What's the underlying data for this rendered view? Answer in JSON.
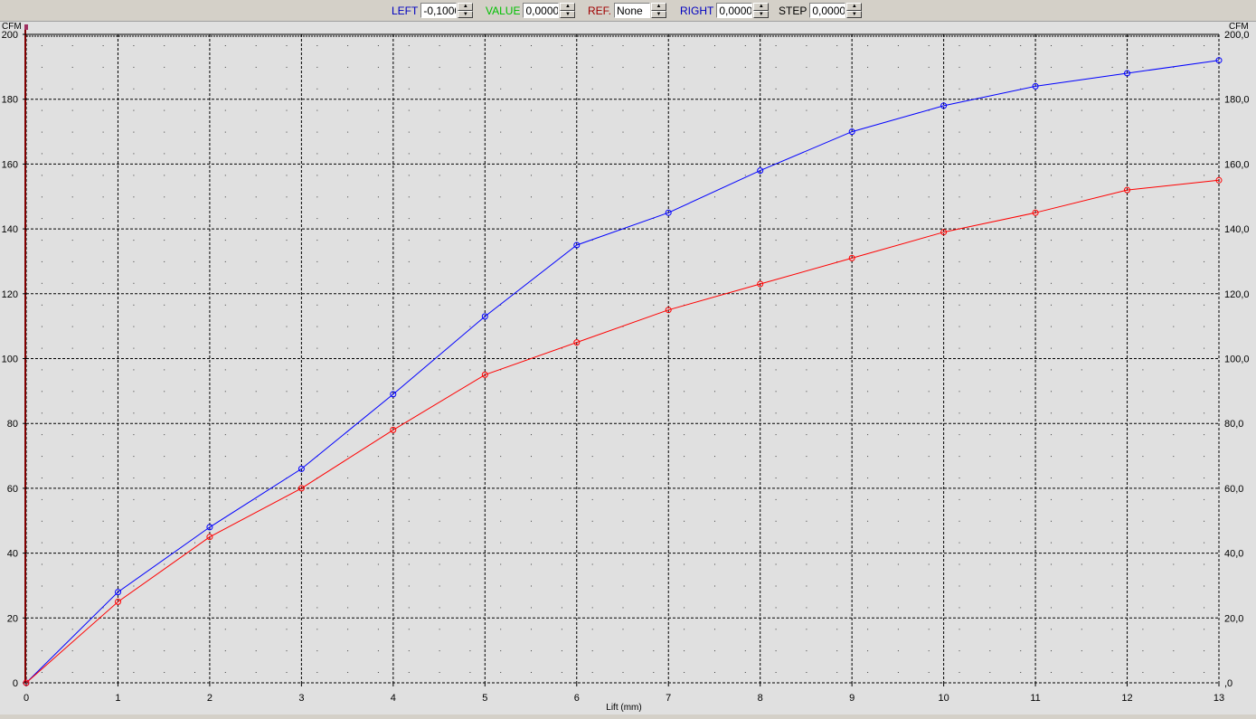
{
  "toolbar": {
    "left": {
      "label": "LEFT",
      "value": "-0,1000",
      "color": "#0000c0"
    },
    "value": {
      "label": "VALUE",
      "value": "0,0000",
      "color": "#00c000"
    },
    "ref": {
      "label": "REF.",
      "value": "None",
      "color": "#a00000"
    },
    "right": {
      "label": "RIGHT",
      "value": "0,0000",
      "color": "#0000c0"
    },
    "step": {
      "label": "STEP",
      "value": "0,0000",
      "color": "#000000"
    }
  },
  "chart_data": {
    "type": "line",
    "xlabel": "Lift (mm)",
    "ylabel_left": "CFM",
    "ylabel_right": "CFM",
    "xlim": [
      0,
      13
    ],
    "ylim": [
      0,
      200
    ],
    "x_ticks": [
      "0",
      "1",
      "2",
      "3",
      "4",
      "5",
      "6",
      "7",
      "8",
      "9",
      "10",
      "11",
      "12",
      "13"
    ],
    "y_ticks_left": [
      "0",
      "20",
      "40",
      "60",
      "80",
      "100",
      "120",
      "140",
      "160",
      "180",
      "200"
    ],
    "y_ticks_right": [
      ",0",
      "20,0",
      "40,0",
      "60,0",
      "80,0",
      "100,0",
      "120,0",
      "140,0",
      "160,0",
      "180,0",
      "200,0"
    ],
    "grid": true,
    "x": [
      0,
      1,
      2,
      3,
      4,
      5,
      6,
      7,
      8,
      9,
      10,
      11,
      12,
      13
    ],
    "series": [
      {
        "color": "#0000ff",
        "values": [
          0,
          28,
          48,
          66,
          89,
          113,
          135,
          145,
          158,
          170,
          178,
          184,
          188,
          192
        ]
      },
      {
        "color": "#ff0000",
        "values": [
          0,
          25,
          45,
          60,
          78,
          95,
          105,
          115,
          123,
          131,
          139,
          145,
          152,
          155
        ]
      }
    ]
  }
}
